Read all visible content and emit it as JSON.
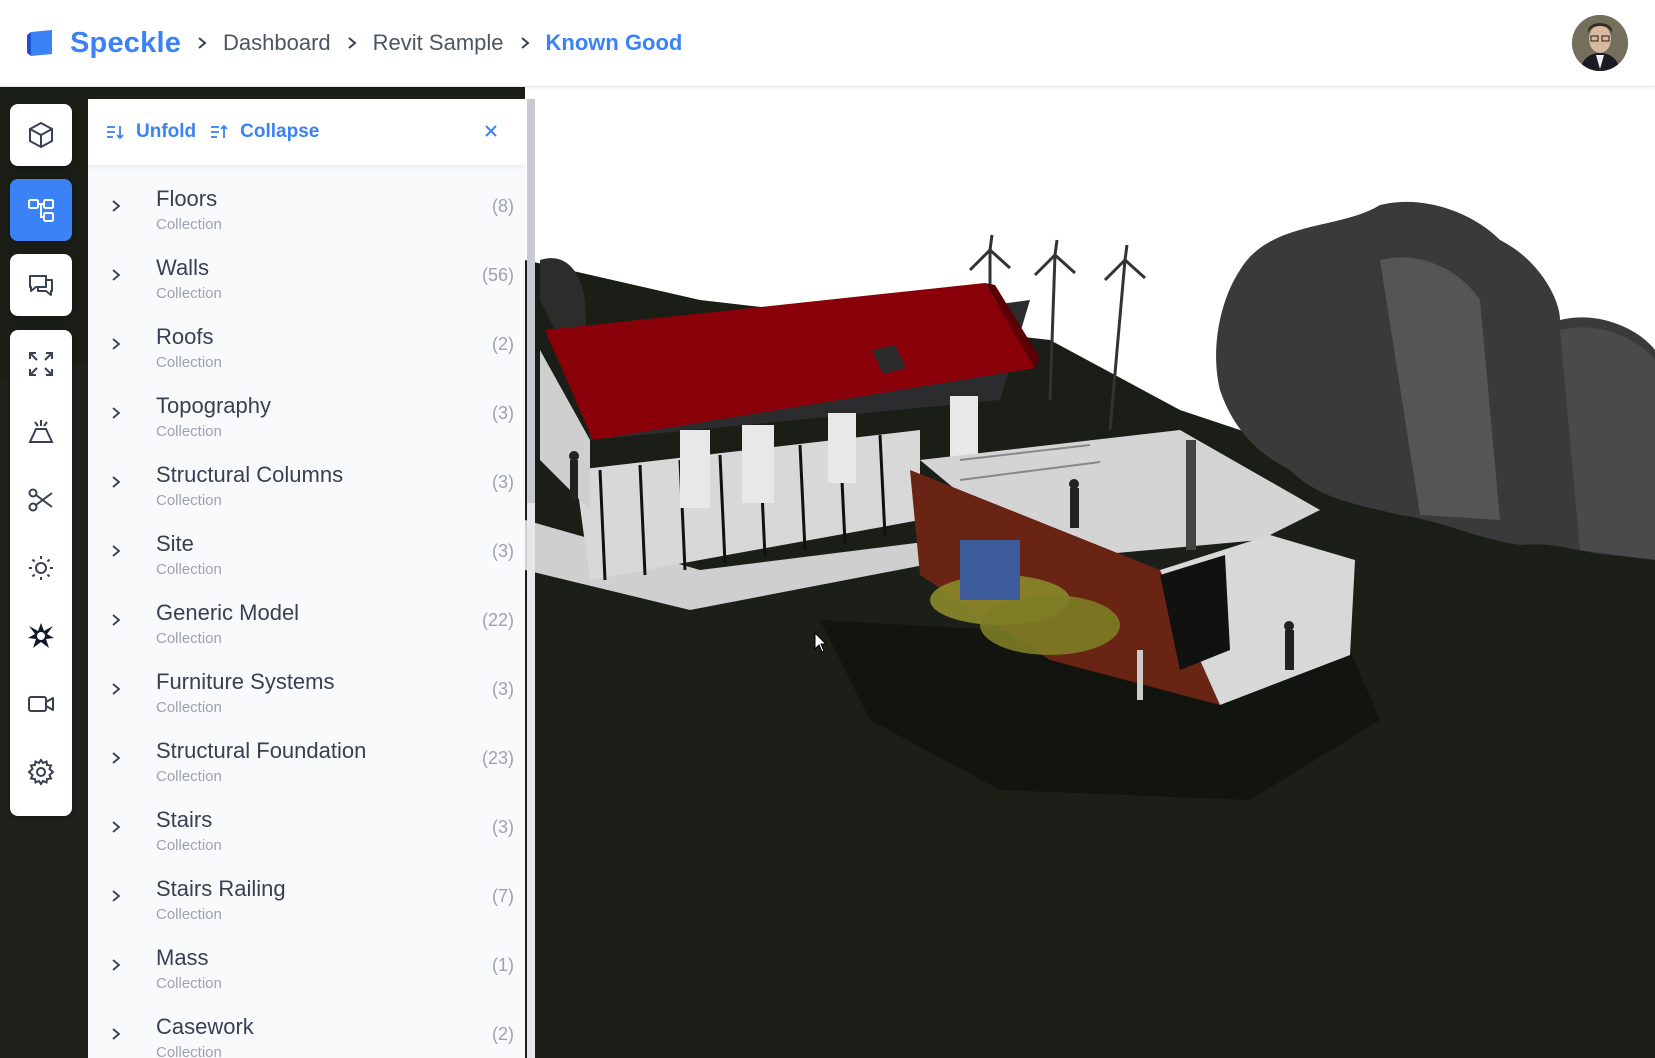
{
  "header": {
    "brand": "Speckle",
    "breadcrumbs": [
      {
        "label": "Dashboard"
      },
      {
        "label": "Revit Sample"
      },
      {
        "label": "Known Good"
      }
    ]
  },
  "colors": {
    "accent": "#3b82f6",
    "roof": "#8a0008",
    "cladding": "#6a2414",
    "ground": "#1b1d17"
  },
  "toolbar": [
    {
      "icon": "cube-icon",
      "active": false
    },
    {
      "icon": "tree-structure-icon",
      "active": true
    },
    {
      "icon": "comments-icon",
      "active": false
    },
    {
      "icon": "zoom-extents-icon",
      "active": false
    },
    {
      "icon": "perspective-icon",
      "active": false
    },
    {
      "icon": "section-cut-icon",
      "active": false
    },
    {
      "icon": "sun-icon",
      "active": false
    },
    {
      "icon": "explode-icon",
      "active": false
    },
    {
      "icon": "camera-icon",
      "active": false
    },
    {
      "icon": "settings-icon",
      "active": false
    }
  ],
  "panel": {
    "unfold_label": "Unfold",
    "collapse_label": "Collapse",
    "items": [
      {
        "name": "Floors",
        "type": "Collection",
        "count": "(8)"
      },
      {
        "name": "Walls",
        "type": "Collection",
        "count": "(56)"
      },
      {
        "name": "Roofs",
        "type": "Collection",
        "count": "(2)"
      },
      {
        "name": "Topography",
        "type": "Collection",
        "count": "(3)"
      },
      {
        "name": "Structural Columns",
        "type": "Collection",
        "count": "(3)"
      },
      {
        "name": "Site",
        "type": "Collection",
        "count": "(3)"
      },
      {
        "name": "Generic Model",
        "type": "Collection",
        "count": "(22)"
      },
      {
        "name": "Furniture Systems",
        "type": "Collection",
        "count": "(3)"
      },
      {
        "name": "Structural Foundation",
        "type": "Collection",
        "count": "(23)"
      },
      {
        "name": "Stairs",
        "type": "Collection",
        "count": "(3)"
      },
      {
        "name": "Stairs Railing",
        "type": "Collection",
        "count": "(7)"
      },
      {
        "name": "Mass",
        "type": "Collection",
        "count": "(1)"
      },
      {
        "name": "Casework",
        "type": "Collection",
        "count": "(2)"
      }
    ]
  }
}
